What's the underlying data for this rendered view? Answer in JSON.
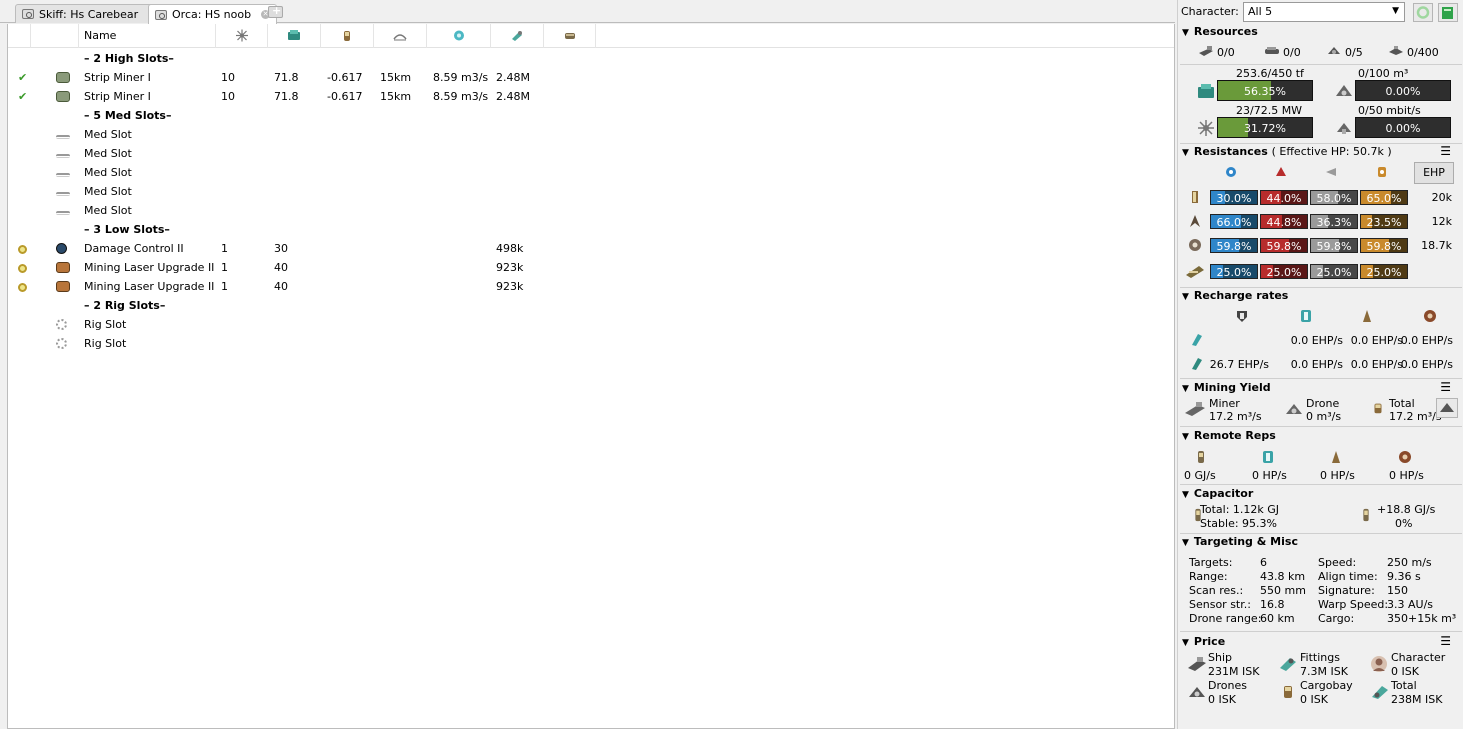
{
  "tabs": [
    {
      "label": "Skiff: Hs Carebear",
      "active": false
    },
    {
      "label": "Orca: HS noob",
      "active": true
    }
  ],
  "fitting": {
    "columns": {
      "name": "Name"
    },
    "rows": [
      {
        "type": "section",
        "name": "– 2 High Slots–"
      },
      {
        "type": "module",
        "state": "online",
        "icon": "strip-miner-icon",
        "name": "Strip Miner I",
        "c1": "10",
        "c2": "71.8",
        "c3": "-0.617",
        "c4": "15km",
        "c5": "8.59 m3/s",
        "c6": "2.48M"
      },
      {
        "type": "module",
        "state": "online",
        "icon": "strip-miner-icon",
        "name": "Strip Miner I",
        "c1": "10",
        "c2": "71.8",
        "c3": "-0.617",
        "c4": "15km",
        "c5": "8.59 m3/s",
        "c6": "2.48M"
      },
      {
        "type": "section",
        "name": "– 5 Med Slots–"
      },
      {
        "type": "empty",
        "icon": "med-slot-icon",
        "name": "Med Slot"
      },
      {
        "type": "empty",
        "icon": "med-slot-icon",
        "name": "Med Slot"
      },
      {
        "type": "empty",
        "icon": "med-slot-icon",
        "name": "Med Slot"
      },
      {
        "type": "empty",
        "icon": "med-slot-icon",
        "name": "Med Slot"
      },
      {
        "type": "empty",
        "icon": "med-slot-icon",
        "name": "Med Slot"
      },
      {
        "type": "section",
        "name": "– 3 Low Slots–"
      },
      {
        "type": "module",
        "state": "passive",
        "icon": "damage-control-icon",
        "name": "Damage Control II",
        "c1": "1",
        "c2": "30",
        "c3": "",
        "c4": "",
        "c5": "",
        "c6": "498k"
      },
      {
        "type": "module",
        "state": "passive",
        "icon": "mining-upgrade-icon",
        "name": "Mining Laser Upgrade II",
        "c1": "1",
        "c2": "40",
        "c3": "",
        "c4": "",
        "c5": "",
        "c6": "923k"
      },
      {
        "type": "module",
        "state": "passive",
        "icon": "mining-upgrade-icon",
        "name": "Mining Laser Upgrade II",
        "c1": "1",
        "c2": "40",
        "c3": "",
        "c4": "",
        "c5": "",
        "c6": "923k"
      },
      {
        "type": "section",
        "name": "– 2 Rig Slots–"
      },
      {
        "type": "empty",
        "icon": "rig-slot-icon",
        "name": "Rig Slot"
      },
      {
        "type": "empty",
        "icon": "rig-slot-icon",
        "name": "Rig Slot"
      }
    ]
  },
  "character": {
    "label": "Character:",
    "value": "All 5"
  },
  "resources": {
    "title": "Resources",
    "counts": [
      "0/0",
      "0/0",
      "0/5",
      "0/400"
    ],
    "cpu": {
      "label": "253.6/450 tf",
      "pct": "56.35%",
      "fill": 0.5635
    },
    "power": {
      "label": "23/72.5 MW",
      "pct": "31.72%",
      "fill": 0.3172
    },
    "dronebay": {
      "label": "0/100 m³",
      "pct": "0.00%",
      "fill": 0
    },
    "bandwidth": {
      "label": "0/50 mbit/s",
      "pct": "0.00%",
      "fill": 0
    }
  },
  "resistances": {
    "title": "Resistances",
    "ehp": "( Effective HP: 50.7k )",
    "ehp_button": "EHP",
    "rows": [
      {
        "values": [
          "30.0%",
          "44.0%",
          "58.0%",
          "65.0%"
        ],
        "fills": [
          0.3,
          0.44,
          0.58,
          0.65
        ],
        "hp": "20k"
      },
      {
        "values": [
          "66.0%",
          "44.8%",
          "36.3%",
          "23.5%"
        ],
        "fills": [
          0.66,
          0.448,
          0.363,
          0.235
        ],
        "hp": "12k"
      },
      {
        "values": [
          "59.8%",
          "59.8%",
          "59.8%",
          "59.8%"
        ],
        "fills": [
          0.598,
          0.598,
          0.598,
          0.598
        ],
        "hp": "18.7k"
      },
      {
        "values": [
          "25.0%",
          "25.0%",
          "25.0%",
          "25.0%"
        ],
        "fills": [
          0.25,
          0.25,
          0.25,
          0.25
        ],
        "hp": ""
      }
    ]
  },
  "recharge": {
    "title": "Recharge rates",
    "row1": [
      "0.0 EHP/s",
      "0.0 EHP/s",
      "0.0 EHP/s"
    ],
    "row2": [
      "26.7 EHP/s",
      "0.0 EHP/s",
      "0.0 EHP/s",
      "0.0 EHP/s"
    ]
  },
  "mining": {
    "title": "Mining Yield",
    "miner": {
      "label": "Miner",
      "value": "17.2 m³/s"
    },
    "drone": {
      "label": "Drone",
      "value": "0 m³/s"
    },
    "total": {
      "label": "Total",
      "value": "17.2 m³/s"
    }
  },
  "remote": {
    "title": "Remote Reps",
    "values": [
      "0 GJ/s",
      "0 HP/s",
      "0 HP/s",
      "0 HP/s"
    ]
  },
  "capacitor": {
    "title": "Capacitor",
    "total": "Total: 1.12k GJ",
    "stable": "Stable: 95.3%",
    "rate": "+18.8 GJ/s",
    "pct": "0%"
  },
  "targeting": {
    "title": "Targeting & Misc",
    "left": [
      {
        "k": "Targets:",
        "v": "6"
      },
      {
        "k": "Range:",
        "v": "43.8 km"
      },
      {
        "k": "Scan res.:",
        "v": "550 mm"
      },
      {
        "k": "Sensor str.:",
        "v": "16.8"
      },
      {
        "k": "Drone range:",
        "v": "60 km"
      }
    ],
    "right": [
      {
        "k": "Speed:",
        "v": "250 m/s"
      },
      {
        "k": "Align time:",
        "v": "9.36 s"
      },
      {
        "k": "Signature:",
        "v": "150"
      },
      {
        "k": "Warp Speed:",
        "v": "3.3 AU/s"
      },
      {
        "k": "Cargo:",
        "v": "350+15k m³"
      }
    ]
  },
  "price": {
    "title": "Price",
    "ship": {
      "label": "Ship",
      "value": "231M ISK"
    },
    "fittings": {
      "label": "Fittings",
      "value": "7.3M ISK"
    },
    "character": {
      "label": "Character",
      "value": "0 ISK"
    },
    "drones": {
      "label": "Drones",
      "value": "0 ISK"
    },
    "cargobay": {
      "label": "Cargobay",
      "value": "0 ISK"
    },
    "total": {
      "label": "Total",
      "value": "238M ISK"
    }
  },
  "colors": {
    "accent_green": "#6a9a3a",
    "em": "#2f86c9",
    "thermal": "#b72c2c",
    "kinetic": "#9a9a9a",
    "explosive": "#c98a2c"
  }
}
